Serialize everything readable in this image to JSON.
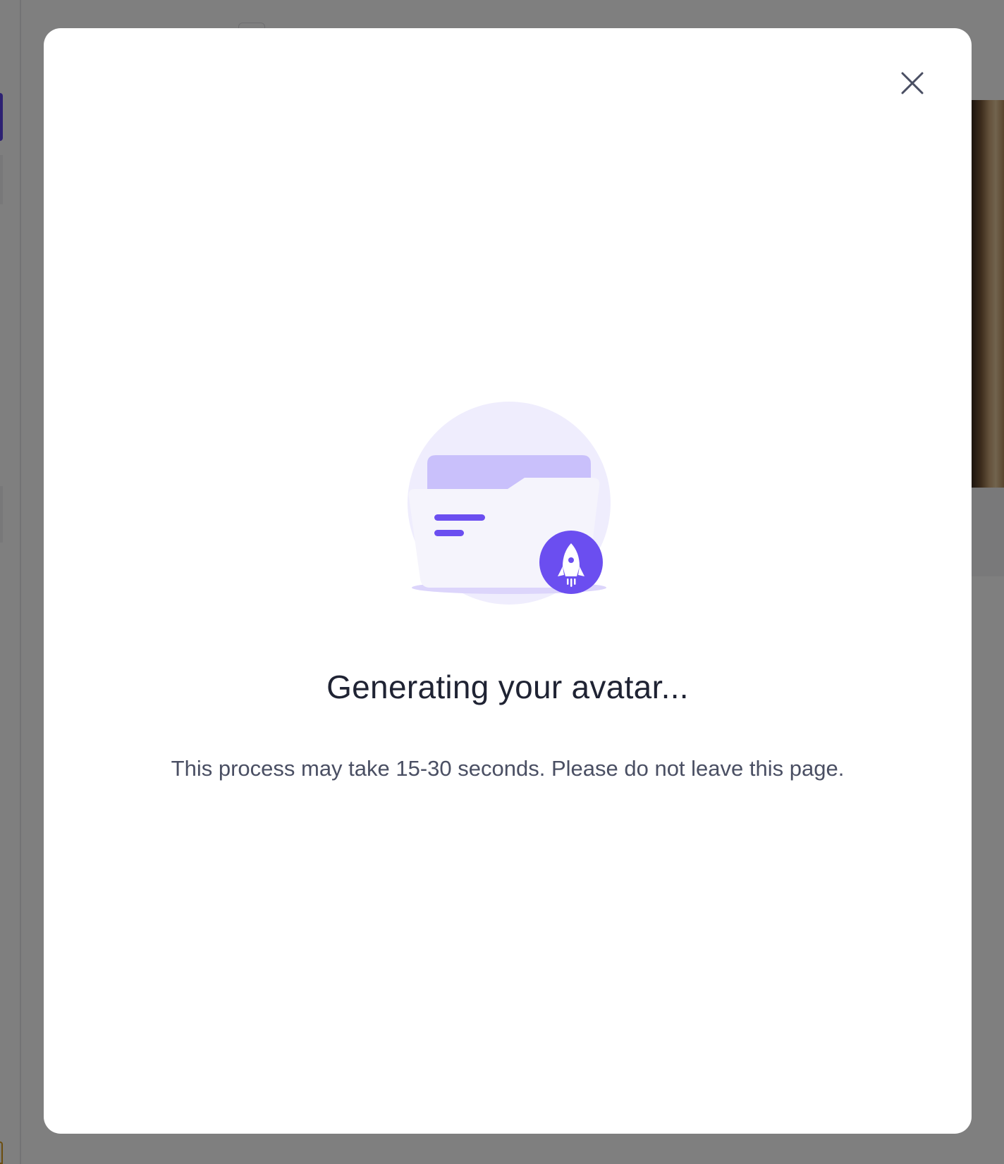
{
  "modal": {
    "title": "Generating your avatar...",
    "message": "This process may take 15-30 seconds. Please do not leave this page.",
    "close_icon": "close-icon",
    "illustration_icon": "folder-rocket-icon"
  },
  "colors": {
    "accent": "#6b4ef0",
    "accent_light": "#c9c0fb",
    "illustration_bg": "#efedfd",
    "overlay": "rgba(0,0,0,0.5)"
  }
}
